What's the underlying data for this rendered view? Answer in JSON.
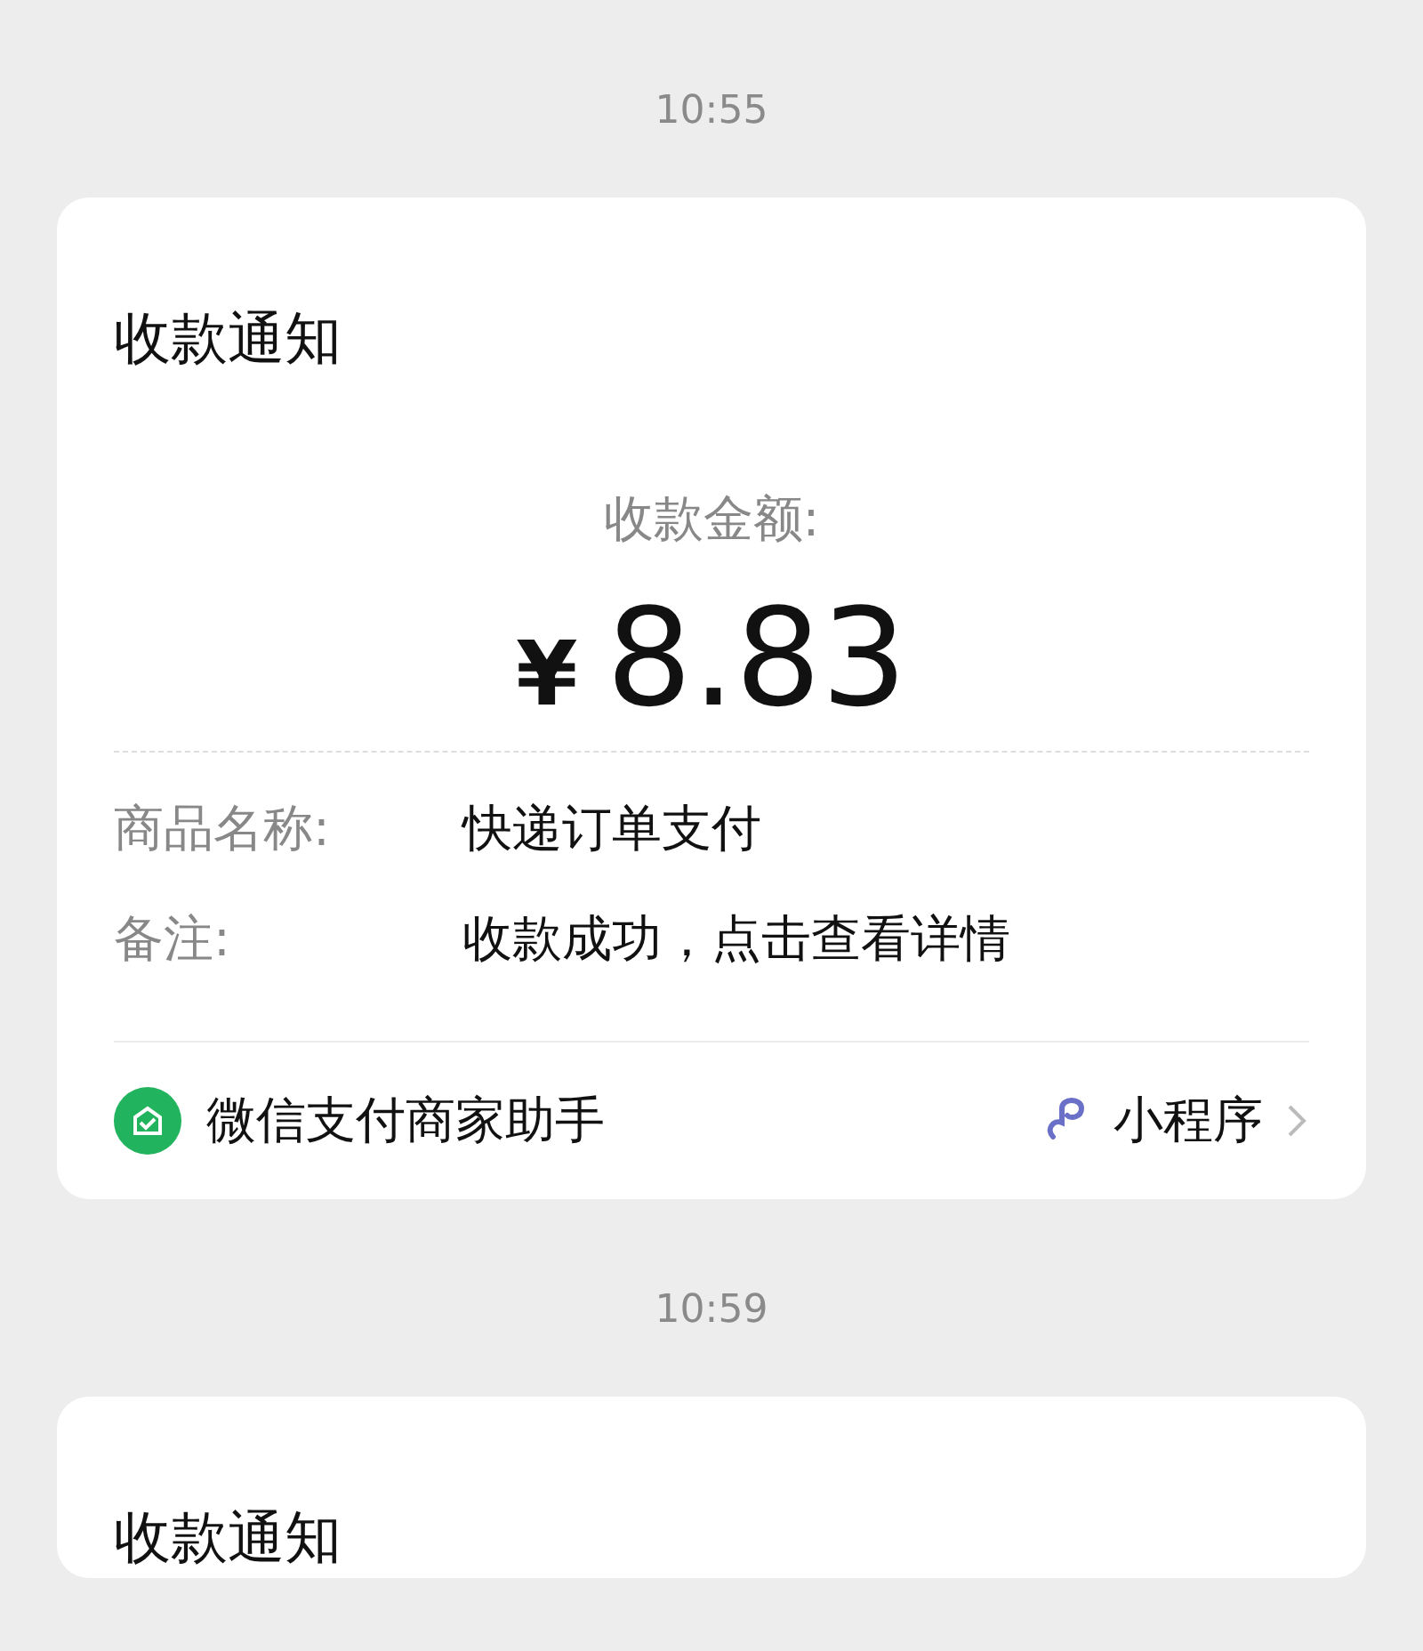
{
  "messages": [
    {
      "time": "10:55",
      "card": {
        "title": "收款通知",
        "amount_label": "收款金额:",
        "currency": "¥",
        "amount": "8.83",
        "fields": [
          {
            "label": "商品名称:",
            "value": "快递订单支付"
          },
          {
            "label": "备注:",
            "value": "收款成功，点击查看详情"
          }
        ],
        "source": "微信支付商家助手",
        "link": "小程序"
      }
    },
    {
      "time": "10:59",
      "card": {
        "title": "收款通知"
      }
    }
  ]
}
